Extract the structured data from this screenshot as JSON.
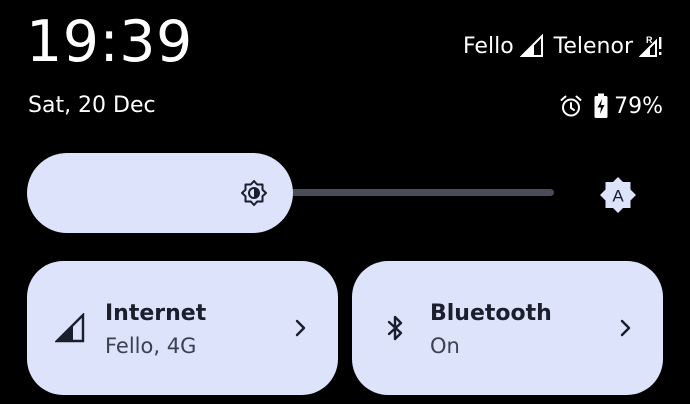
{
  "status": {
    "time": "19:39",
    "date": "Sat, 20 Dec",
    "carrier_1": "Fello",
    "carrier_2": "Telenor",
    "battery_percent": "79%",
    "icons": [
      "signal-icon",
      "signal-roaming-icon",
      "alarm-icon",
      "battery-charging-icon"
    ]
  },
  "brightness": {
    "level": 0.42,
    "icon": "brightness-icon",
    "auto_icon": "auto-brightness-icon",
    "auto_label": "A"
  },
  "tiles": [
    {
      "title": "Internet",
      "subtitle": "Fello, 4G",
      "icon": "signal-icon"
    },
    {
      "title": "Bluetooth",
      "subtitle": "On",
      "icon": "bluetooth-icon"
    }
  ],
  "colors": {
    "background": "#000000",
    "tile_bg": "#dce3fa",
    "tile_text": "#1a1e2d",
    "track": "#4a4d57"
  }
}
